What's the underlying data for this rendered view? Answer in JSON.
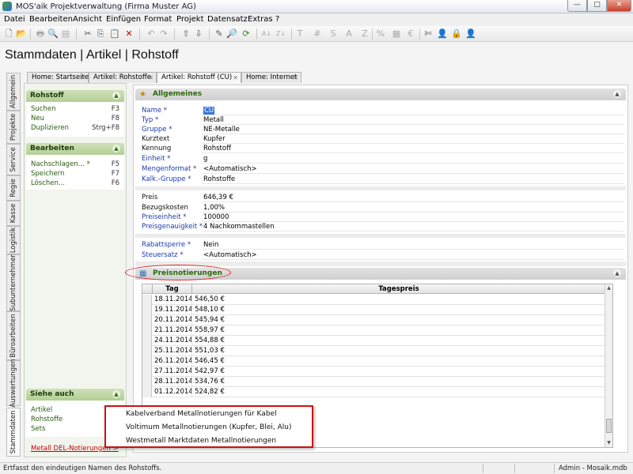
{
  "window": {
    "title": "MOS'aik Projektverwaltung (Firma Muster AG)",
    "min": "—",
    "max": "□",
    "close": "✕"
  },
  "menu": [
    "Datei",
    "Bearbeiten",
    "Ansicht",
    "Einfügen",
    "Format",
    "Projekt",
    "Datensatz",
    "Extras",
    "?"
  ],
  "toolbar": {
    "icons": [
      "new-icon",
      "open-icon",
      "print-icon",
      "print-preview-icon",
      "preview-icon",
      "cut-icon",
      "copy-icon",
      "paste-icon",
      "delete-icon",
      "undo-icon",
      "redo-icon",
      "up-icon",
      "down-icon",
      "edit-icon",
      "search-icon",
      "refresh-icon",
      "sort-icon",
      "sort-desc-icon",
      "text-icon",
      "hash-icon",
      "s-icon",
      "a-icon",
      "z-icon",
      "percent-icon",
      "calc-icon",
      "euro-icon",
      "tools-icon",
      "user-blue-icon",
      "lock-icon",
      "user-red-icon"
    ],
    "glyphs": [
      "🗋",
      "📂",
      "🖶",
      "🔍",
      "▤",
      "✂",
      "⎘",
      "📋",
      "✕",
      "↶",
      "↷",
      "⇧",
      "⇩",
      "✎",
      "🔎",
      "⟳",
      "A↓",
      "Z↓",
      "T",
      "#",
      "S",
      "A",
      "Z",
      "%",
      "▦",
      "€",
      "✄",
      "👤",
      "🔒",
      "👤"
    ]
  },
  "page_title": "Stammdaten | Artikel | Rohstoff",
  "tabs": [
    {
      "label": "Home: Startseite",
      "active": false
    },
    {
      "label": "Artikel: Rohstoffe",
      "active": false
    },
    {
      "label": "Artikel: Rohstoff (CU)",
      "active": true
    },
    {
      "label": "Home: Internet",
      "active": false
    }
  ],
  "vertical_tabs": [
    "Allgemein",
    "Projekte",
    "Service",
    "Regie",
    "Kasse",
    "Logistik",
    "Subunternehmer",
    "Büroarbeiten",
    "Auswertungen",
    "Stammdaten"
  ],
  "left_panel": {
    "rohstoff": {
      "title": "Rohstoff",
      "items": [
        {
          "label": "Suchen",
          "key": "F3"
        },
        {
          "label": "Neu",
          "key": "F8"
        },
        {
          "label": "Duplizieren",
          "key": "Strg+F8"
        }
      ]
    },
    "bearbeiten": {
      "title": "Bearbeiten",
      "items": [
        {
          "label": "Nachschlagen... *",
          "key": "F5"
        },
        {
          "label": "Speichern",
          "key": "F7"
        },
        {
          "label": "Löschen...",
          "key": "F6"
        }
      ]
    },
    "siehe_auch": {
      "title": "Siehe auch",
      "items": [
        "Artikel",
        "Rohstoffe",
        "Sets"
      ]
    },
    "metall_link": "Metall DEL-Notierungen >"
  },
  "allgemeines": {
    "title": "Allgemeines",
    "fields": [
      {
        "label": "Name *",
        "value": "CU",
        "required": true,
        "selected": true
      },
      {
        "label": "Typ *",
        "value": "Metall",
        "required": true
      },
      {
        "label": "Gruppe *",
        "value": "NE-Metalle",
        "required": true
      },
      {
        "label": "Kurztext",
        "value": "Kupfer",
        "required": false
      },
      {
        "label": "Kennung",
        "value": "Rohstoff",
        "required": false
      },
      {
        "label": "Einheit *",
        "value": "g",
        "required": true
      },
      {
        "label": "Mengenformat *",
        "value": "<Automatisch>",
        "required": true
      },
      {
        "label": "Kalk.-Gruppe *",
        "value": "Rohstoffe",
        "required": true
      }
    ],
    "price_fields": [
      {
        "label": "Preis",
        "value": "646,39 €",
        "required": false
      },
      {
        "label": "Bezugskosten",
        "value": "1,00%",
        "required": false
      },
      {
        "label": "Preiseinheit *",
        "value": "100000",
        "required": true
      },
      {
        "label": "Preisgenauigkeit *",
        "value": "4 Nachkommastellen",
        "required": true
      }
    ],
    "other_fields": [
      {
        "label": "Rabattsperre *",
        "value": "Nein",
        "required": true
      },
      {
        "label": "Steuersatz *",
        "value": "<Automatisch>",
        "required": true
      }
    ]
  },
  "preisnotierungen": {
    "title": "Preisnotierungen",
    "columns": [
      "Tag",
      "Tagespreis"
    ],
    "rows": [
      {
        "tag": "18.11.2014",
        "preis": "546,50 €"
      },
      {
        "tag": "19.11.2014",
        "preis": "548,10 €"
      },
      {
        "tag": "20.11.2014",
        "preis": "545,94 €"
      },
      {
        "tag": "21.11.2014",
        "preis": "558,97 €"
      },
      {
        "tag": "24.11.2014",
        "preis": "554,88 €"
      },
      {
        "tag": "25.11.2014",
        "preis": "551,03 €"
      },
      {
        "tag": "26.11.2014",
        "preis": "546,45 €"
      },
      {
        "tag": "27.11.2014",
        "preis": "542,97 €"
      },
      {
        "tag": "28.11.2014",
        "preis": "534,76 €"
      },
      {
        "tag": "01.12.2014",
        "preis": "524,82 €"
      }
    ]
  },
  "popup": {
    "items": [
      "Kabelverband Metallnotierungen für Kabel",
      "Voltimum Metallnotierungen (Kupfer, Blei, Alu)",
      "Westmetall Marktdaten Metallnotierungen"
    ]
  },
  "status": {
    "message": "Ertfasst den eindeutigen Namen des Rohstoffs.",
    "user": "Admin - Mosaik.mdb"
  },
  "colors": {
    "accent_green": "#2b6a0c",
    "required_blue": "#1d3aa8",
    "annotation_red": "#e02020"
  }
}
